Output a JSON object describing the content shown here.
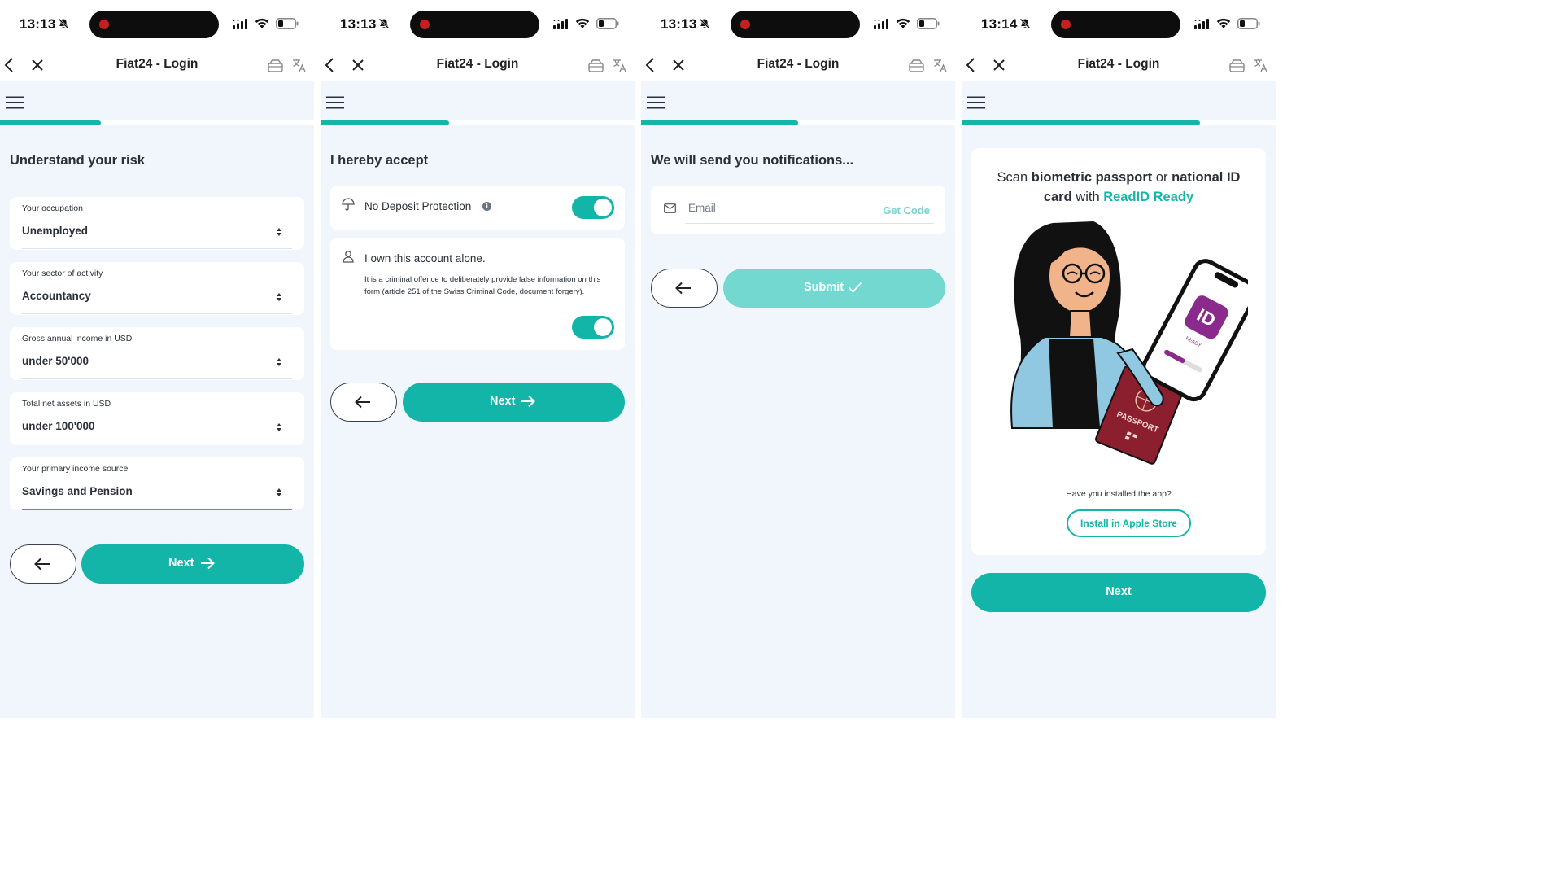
{
  "status": {
    "time_1": "13:13",
    "time_2": "13:13",
    "time_3": "13:13",
    "time_4": "13:14"
  },
  "nav": {
    "title": "Fiat24 - Login"
  },
  "progress": {
    "screen_1": 0.32,
    "screen_2": 0.41,
    "screen_3": 0.5,
    "screen_4": 0.76
  },
  "colors": {
    "accent": "#12b5a7",
    "accent_disabled": "#72d8d0",
    "background": "#f1f5fc",
    "passport": "#8b1f2e",
    "readid": "#8a2a8c"
  },
  "screen1": {
    "heading": "Understand your risk",
    "fields": [
      {
        "label": "Your occupation",
        "value": "Unemployed"
      },
      {
        "label": "Your sector of activity",
        "value": "Accountancy"
      },
      {
        "label": "Gross annual income in USD",
        "value": "under 50'000"
      },
      {
        "label": "Total net assets in USD",
        "value": "under 100'000"
      },
      {
        "label": "Your primary income source",
        "value": "Savings and Pension"
      }
    ],
    "next_label": "Next"
  },
  "screen2": {
    "heading": "I hereby accept",
    "option_1": {
      "text": "No Deposit Protection",
      "info_glyph": "i",
      "enabled": true
    },
    "option_2": {
      "text": "I own this account alone.",
      "legal": "It is a criminal offence to deliberately provide false information on this form (article 251 of the Swiss Criminal Code, document forgery).",
      "enabled": true
    },
    "next_label": "Next"
  },
  "screen3": {
    "heading": "We will send you notifications...",
    "email_placeholder": "Email",
    "get_code_label": "Get Code",
    "submit_label": "Submit"
  },
  "screen4": {
    "title_parts": {
      "p1": "Scan ",
      "b1": "biometric passport",
      "p2": " or ",
      "b2": "national ID card",
      "p3": " with ",
      "brand": "ReadID Ready"
    },
    "illustration_text": {
      "app": "ID",
      "app_sub": "READY",
      "passport": "PASSPORT"
    },
    "installed_question": "Have you installed the app?",
    "install_label": "Install in Apple Store",
    "next_label": "Next"
  }
}
